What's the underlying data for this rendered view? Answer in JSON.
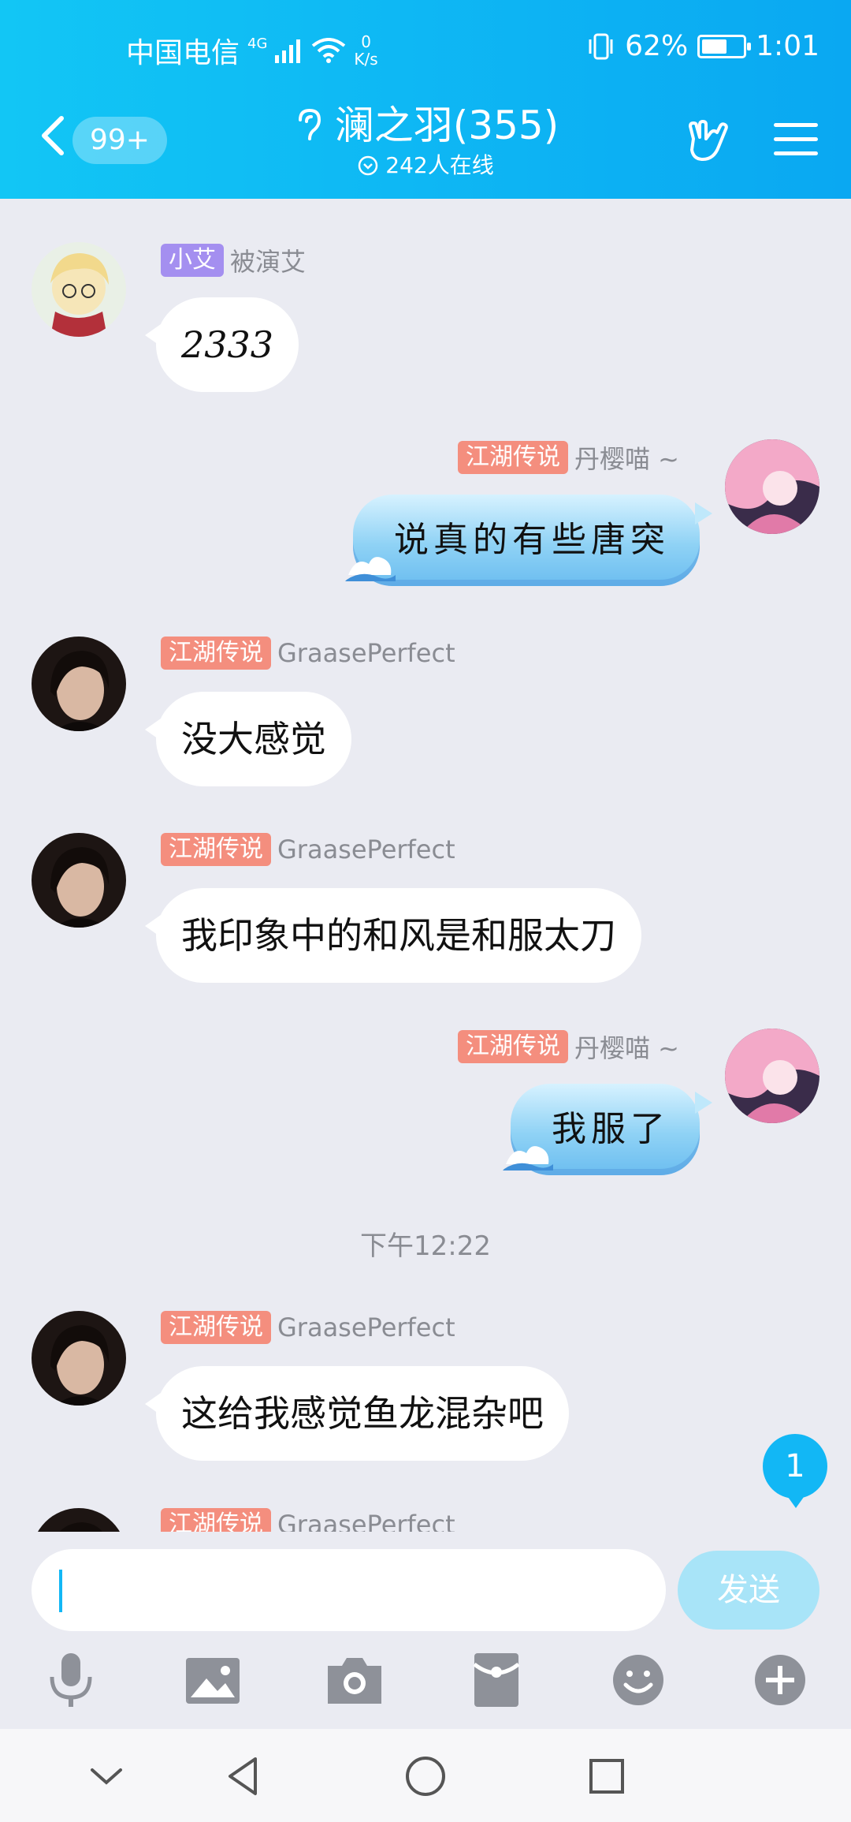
{
  "status_bar": {
    "carrier": "中国电信",
    "network": "4G",
    "speed_value": "0",
    "speed_unit": "K/s",
    "battery": "62%",
    "battery_level": 0.62,
    "time": "1:01"
  },
  "header": {
    "back_badge": "99+",
    "title": "澜之羽(355)",
    "online": "242人在线"
  },
  "messages": [
    {
      "side": "left",
      "tag": "小艾",
      "tag_color": "#a48ff0",
      "name": "被演艾",
      "text": "2333"
    },
    {
      "side": "right",
      "tag": "江湖传说",
      "tag_color": "#f48e7e",
      "name": "丹樱喵 ~",
      "text": "说真的有些唐突"
    },
    {
      "side": "left",
      "tag": "江湖传说",
      "tag_color": "#f48e7e",
      "name": "GraasePerfect",
      "text": "没大感觉"
    },
    {
      "side": "left",
      "tag": "江湖传说",
      "tag_color": "#f48e7e",
      "name": "GraasePerfect",
      "text": "我印象中的和风是和服太刀"
    },
    {
      "side": "right",
      "tag": "江湖传说",
      "tag_color": "#f48e7e",
      "name": "丹樱喵 ~",
      "text": "我服了"
    },
    {
      "side": "left",
      "tag": "江湖传说",
      "tag_color": "#f48e7e",
      "name": "GraasePerfect",
      "text": "这给我感觉鱼龙混杂吧"
    },
    {
      "side": "left",
      "tag": "江湖传说",
      "tag_color": "#f48e7e",
      "name": "GraasePerfect",
      "text": ""
    }
  ],
  "timestamp": "下午12:22",
  "unread_count": "1",
  "composer": {
    "value": "",
    "send_label": "发送"
  },
  "icons": {
    "tools": [
      "microphone-icon",
      "image-icon",
      "camera-icon",
      "red-packet-icon",
      "emoji-icon",
      "plus-icon"
    ],
    "system_nav": [
      "collapse-icon",
      "back-icon",
      "home-icon",
      "recents-icon"
    ]
  },
  "colors": {
    "header_accent": "#0aa8f2",
    "tag_orange": "#f48e7e",
    "tag_purple": "#a48ff0",
    "send_disabled": "#a8e4f8"
  }
}
